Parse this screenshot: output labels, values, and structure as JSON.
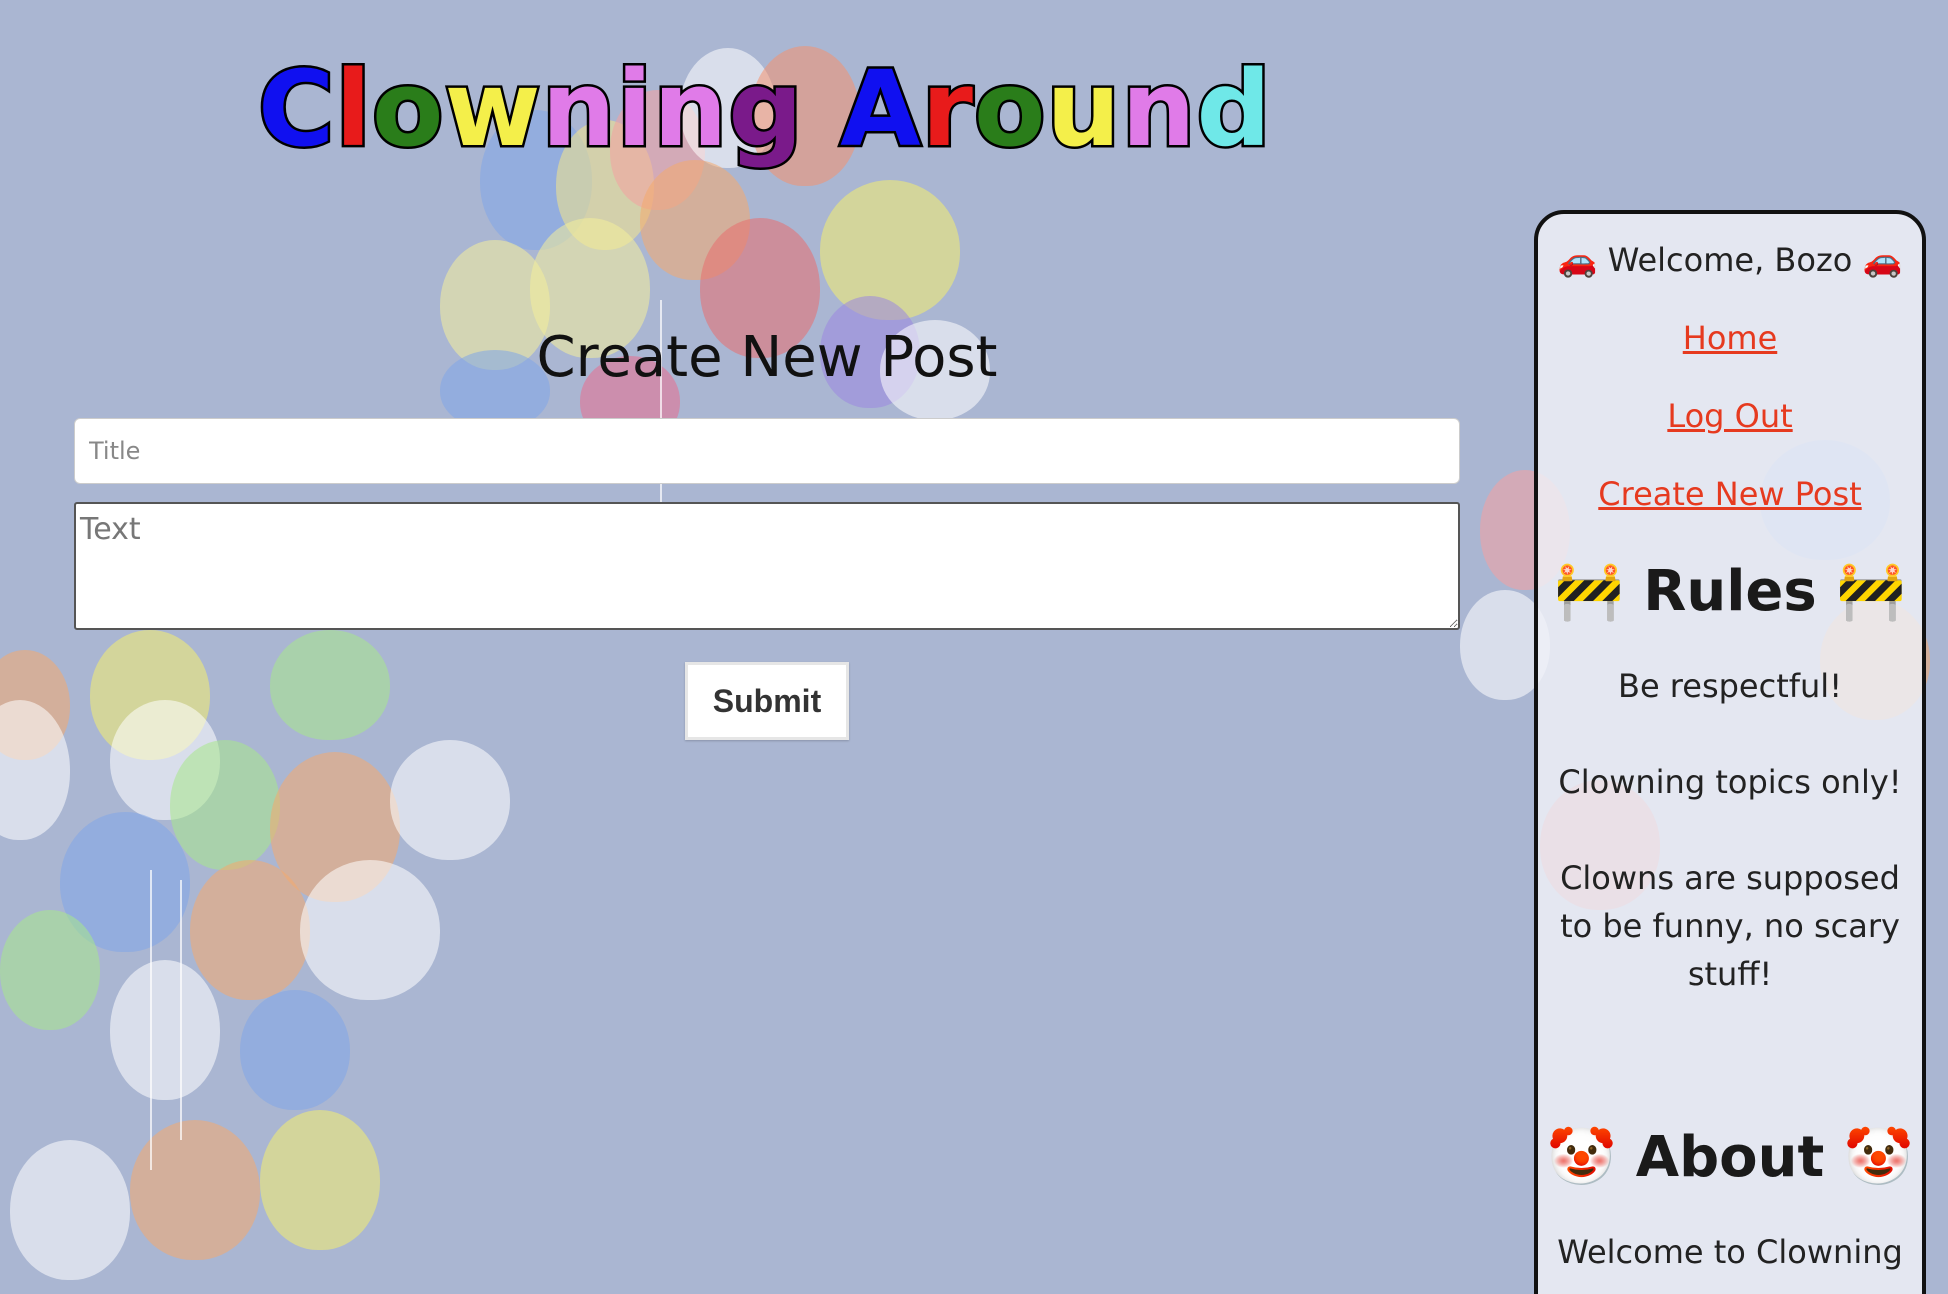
{
  "site": {
    "title_letters": [
      {
        "char": "C",
        "color": "#1010f0"
      },
      {
        "char": "l",
        "color": "#e81b1b"
      },
      {
        "char": "o",
        "color": "#2a7d1a"
      },
      {
        "char": "w",
        "color": "#f4ef4a"
      },
      {
        "char": "n",
        "color": "#e07be8"
      },
      {
        "char": "i",
        "color": "#e07be8"
      },
      {
        "char": "n",
        "color": "#e07be8"
      },
      {
        "char": "g",
        "color": "#7a1a8a"
      },
      {
        "char": " ",
        "color": "#000000"
      },
      {
        "char": "A",
        "color": "#1010f0"
      },
      {
        "char": "r",
        "color": "#e81b1b"
      },
      {
        "char": "o",
        "color": "#2a7d1a"
      },
      {
        "char": "u",
        "color": "#f4ef4a"
      },
      {
        "char": "n",
        "color": "#e07be8"
      },
      {
        "char": "d",
        "color": "#6fe8e8"
      }
    ]
  },
  "form": {
    "heading": "Create New Post",
    "title_placeholder": "Title",
    "title_value": "",
    "text_placeholder": "Text",
    "text_value": "",
    "submit_label": "Submit"
  },
  "sidebar": {
    "welcome": "🚗 Welcome, Bozo 🚗",
    "nav": {
      "home": "Home",
      "logout": "Log Out",
      "create_post": "Create New Post"
    },
    "rules_heading": "🚧 Rules 🚧",
    "rules": [
      "Be respectful!",
      "Clowning topics only!",
      "Clowns are supposed to be funny, no scary stuff!"
    ],
    "about_heading": "🤡 About 🤡",
    "about_text": "Welcome to Clowning"
  },
  "colors": {
    "background": "#aab6d2",
    "link": "#e63a1f"
  }
}
